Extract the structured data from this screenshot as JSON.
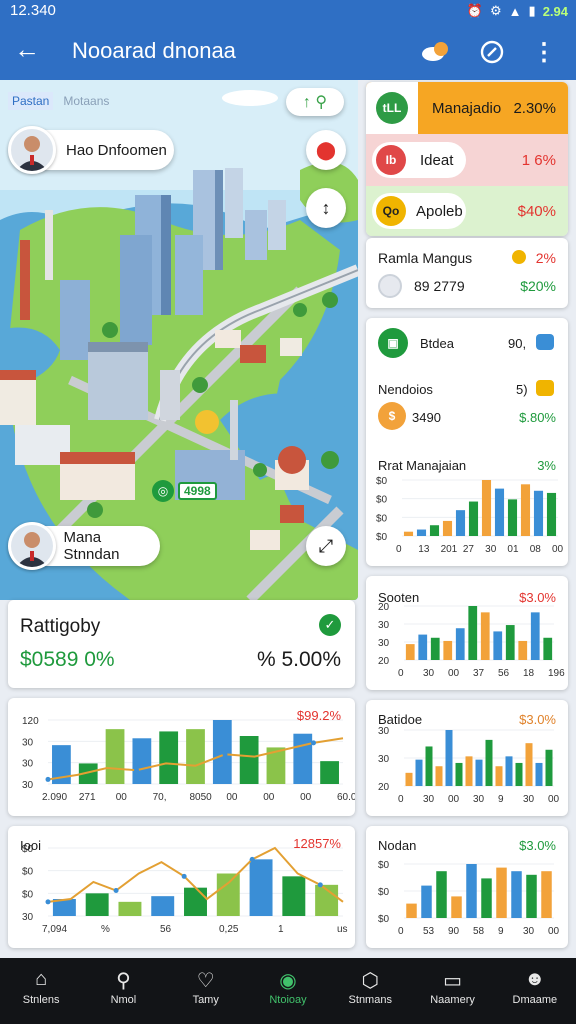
{
  "status": {
    "time": "12.340",
    "battery": "2.94"
  },
  "appbar": {
    "title": "Nooarad dnonaa",
    "back_icon": "arrow-left-icon",
    "actions": [
      "location-pin-icon",
      "compass-icon",
      "more-vertical-icon"
    ]
  },
  "map": {
    "tabs": [
      "Pastan",
      "Motaans"
    ],
    "search_icon": "search-icon",
    "person_top": "Hao Dnfoomen",
    "person_bottom": "Mana Stnndan",
    "marker_label": "4998"
  },
  "sidebar": {
    "top_items": [
      {
        "label": "Manajadio",
        "value": "2.30%",
        "icon_text": "tLL",
        "color": "#2e9b45"
      },
      {
        "label": "Ideat",
        "value": "1 6%",
        "icon_text": "Ib",
        "color": "#e04848"
      },
      {
        "label": "Apoleb",
        "value": "$40%",
        "icon_text": "Qo",
        "color": "#f0b400"
      }
    ],
    "list_card": {
      "title": "Ramla Mangus",
      "pct": "2%",
      "sub": "89 2779",
      "sub_pct": "$20%"
    },
    "card2": {
      "row1_label": "Btdea",
      "row1_value": "90,",
      "row2_label": "Nendoios",
      "row2_value": "5)",
      "row3_label": "3490",
      "row3_value": "$.80%",
      "chart_title": "Rrat Manajaian",
      "chart_pct": "3%"
    },
    "card3": {
      "title": "Sooten",
      "pct": "$3.0%"
    },
    "card4": {
      "title": "Batidoe",
      "pct": "$3.0%"
    },
    "card5": {
      "title": "Nodan",
      "pct": "$3.0%"
    }
  },
  "summary": {
    "title": "Rattigoby",
    "value": "$0589 0%",
    "right": "% 5.00%"
  },
  "bottom_cards": {
    "card_a": {
      "pct": "$99.2%",
      "x_ticks": [
        "2.090",
        "271",
        "00",
        "70,",
        "8050",
        "00",
        "00",
        "00",
        "60.00"
      ]
    },
    "card_b": {
      "title": "Iooi",
      "pct": "12857%",
      "x_ticks": [
        "7,094",
        "%",
        "56",
        "0,25",
        "1",
        "us"
      ]
    }
  },
  "nav": {
    "items": [
      {
        "label": "Stnlens",
        "icon": "home-icon"
      },
      {
        "label": "Nmol",
        "icon": "search-icon"
      },
      {
        "label": "Tamy",
        "icon": "heart-icon"
      },
      {
        "label": "Ntoioay",
        "icon": "leaf-icon"
      },
      {
        "label": "Stnmans",
        "icon": "box-icon"
      },
      {
        "label": "Naamery",
        "icon": "tablet-icon"
      },
      {
        "label": "Dmaame",
        "icon": "person-icon"
      }
    ]
  },
  "chart_data": [
    {
      "type": "bar",
      "title": "Rrat Manajaian",
      "ylabels": [
        "$0",
        "$0",
        "$0",
        "$0"
      ],
      "categories": [
        "0",
        "13",
        "201",
        "27",
        "30",
        "01",
        "08",
        "00"
      ],
      "values": [
        2,
        3,
        5,
        7,
        12,
        16,
        26,
        22,
        17,
        24,
        21,
        20
      ]
    },
    {
      "type": "bar",
      "title": "Sooten",
      "ylabels": [
        "20",
        "30",
        "30",
        "20"
      ],
      "categories": [
        "0",
        "30",
        "00",
        "37",
        "56",
        "18",
        "196"
      ],
      "values": [
        10,
        16,
        14,
        12,
        20,
        34,
        30,
        18,
        22,
        12,
        30,
        14
      ]
    },
    {
      "type": "bar",
      "title": "Batidoe",
      "ylabels": [
        "30",
        "30",
        "20"
      ],
      "categories": [
        "0",
        "30",
        "00",
        "30",
        "9",
        "30",
        "00"
      ],
      "values": [
        8,
        16,
        24,
        12,
        34,
        14,
        18,
        16,
        28,
        12,
        18,
        14,
        26,
        14,
        22
      ]
    },
    {
      "type": "bar",
      "title": "Nodan",
      "ylabels": [
        "$0",
        "$0",
        "$0"
      ],
      "categories": [
        "0",
        "53",
        "90",
        "58",
        "9",
        "30",
        "00"
      ],
      "values": [
        8,
        18,
        26,
        12,
        30,
        22,
        28,
        26,
        24,
        26
      ]
    },
    {
      "type": "bar",
      "ylabels": [
        "120",
        "30",
        "30",
        "30"
      ],
      "values": [
        34,
        18,
        48,
        40,
        46,
        48,
        56,
        42,
        32,
        44,
        20
      ],
      "line": [
        4,
        8,
        14,
        12,
        18,
        16,
        26,
        24,
        30,
        36,
        40
      ]
    },
    {
      "type": "bar",
      "ylabels": [
        "$0",
        "$0",
        "$0",
        "30"
      ],
      "values": [
        12,
        16,
        10,
        14,
        20,
        30,
        40,
        28,
        22
      ],
      "line": [
        10,
        12,
        24,
        18,
        30,
        38,
        28,
        12,
        24,
        40,
        48,
        30,
        22,
        10
      ]
    }
  ]
}
